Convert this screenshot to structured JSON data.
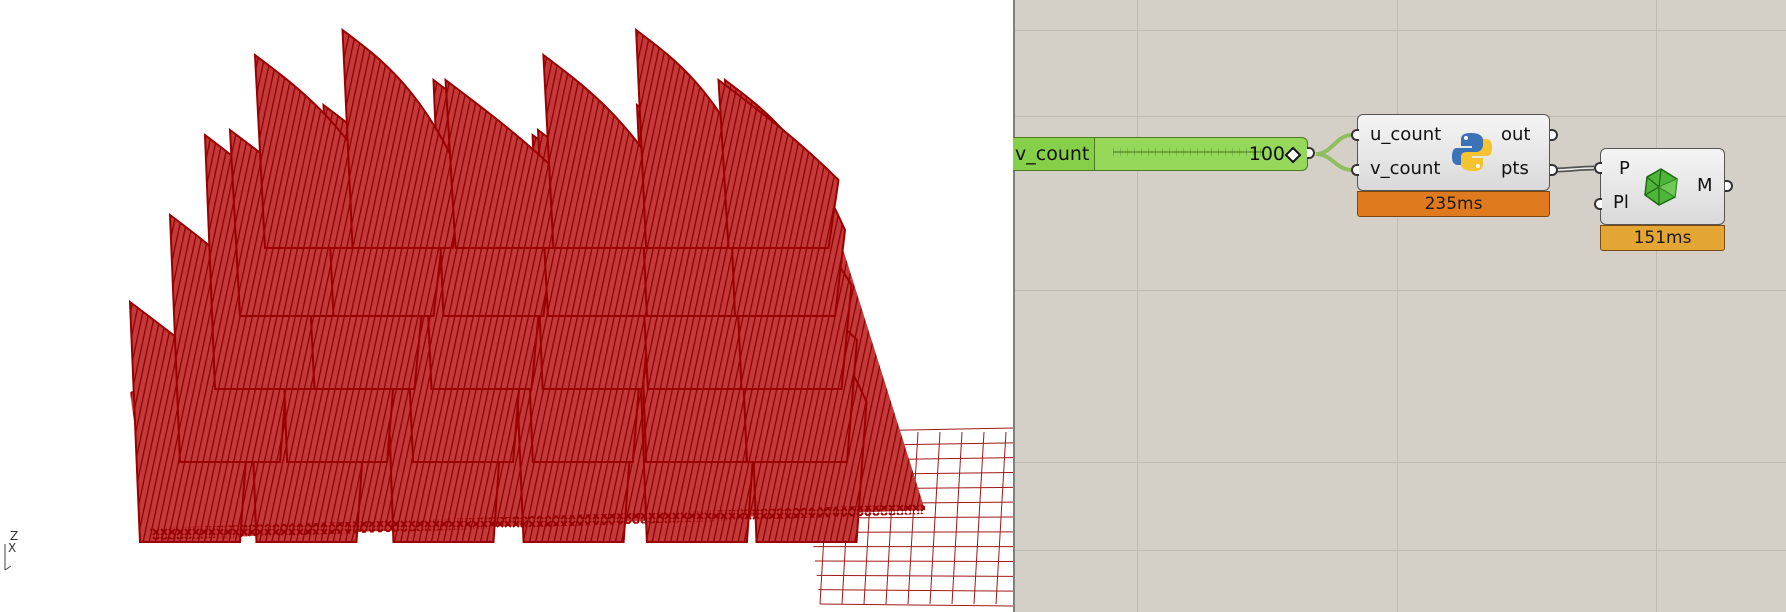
{
  "viewport": {
    "axis_labels": {
      "z": "Z",
      "x": "X"
    },
    "colors": {
      "mesh": "#9a0000",
      "grid": "#a01818",
      "background": "#ffffff"
    }
  },
  "canvas": {
    "slider": {
      "name": "v_count",
      "value": "100"
    },
    "python_component": {
      "inputs": [
        "u_count",
        "v_count"
      ],
      "outputs": [
        "out",
        "pts"
      ],
      "timing": "235ms",
      "timing_color": "#e07a1e",
      "icon": "python-icon"
    },
    "mesh_component": {
      "inputs": [
        "P",
        "Pl"
      ],
      "outputs": [
        "M"
      ],
      "timing": "151ms",
      "timing_color": "#e3a534",
      "icon": "mesh-icon"
    },
    "colors": {
      "background": "#d4d0c8",
      "slider": "#95d85a",
      "wire": "#8fbe5e"
    }
  }
}
